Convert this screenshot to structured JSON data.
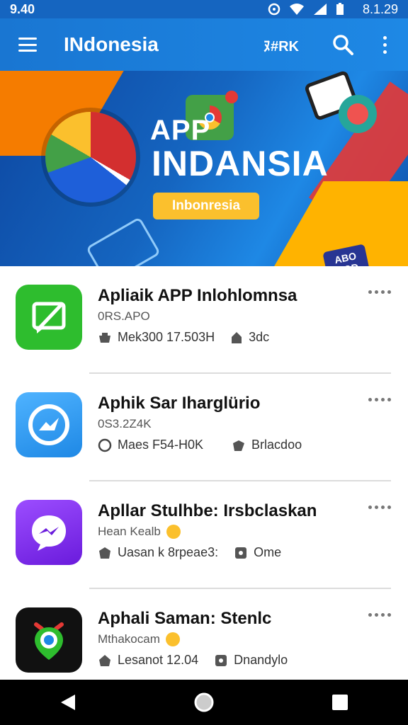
{
  "status_bar": {
    "time_left": "9.40",
    "time_right": "8.1.29"
  },
  "app_bar": {
    "title": "INdonesia",
    "action_label": "ﾇ#RK"
  },
  "banner": {
    "app_line": "APP",
    "headline": "INDANSIA",
    "pill_text": "Inbonresia",
    "tag_text": "ABO\nDOD"
  },
  "apps": [
    {
      "name": "Apliaik APP Inlohlomnsa",
      "subtitle": "0RS.APO",
      "meta1": "Mek300 17.503H",
      "meta2": "3dc",
      "icon_color": "#2ebd2e"
    },
    {
      "name": "Aphik Sar Iharglürio",
      "subtitle": "0S3.2Z4K",
      "meta1": "Maes F54-H0K",
      "meta2": "Brlacdoo",
      "icon_color": "#1e88e5"
    },
    {
      "name": "Apllar Stulhbe: Irsbclaskan",
      "subtitle": "Hean Kealb",
      "meta1": "Uasan k 8rpeae3:",
      "meta2": "Ome",
      "icon_color": "#7c3aed"
    },
    {
      "name": "Aphali Saman: Stenlc",
      "subtitle": "Mthakocam",
      "meta1": "Lesanot 12.04",
      "meta2": "Dnandylo",
      "icon_color": "#111111"
    }
  ]
}
